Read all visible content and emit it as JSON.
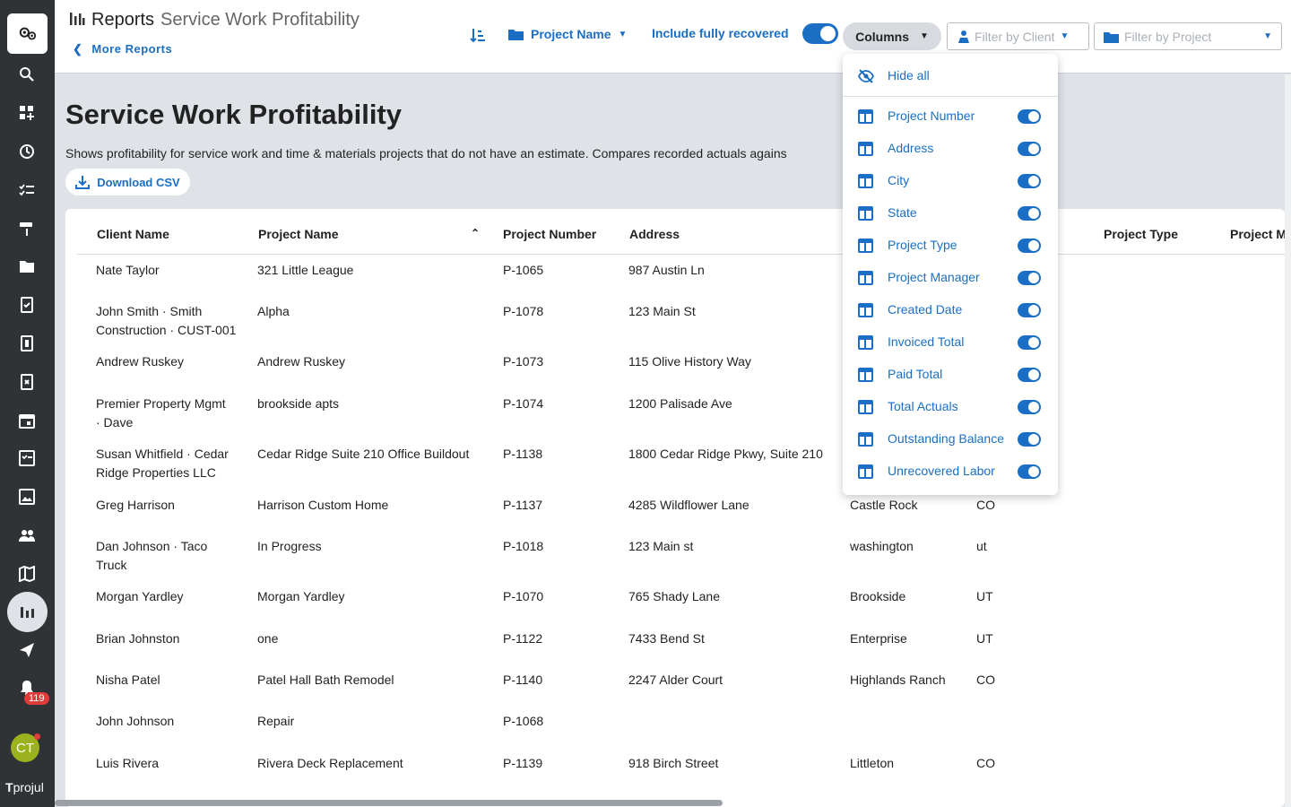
{
  "app": {
    "brand": "projul",
    "notification_count": "119",
    "avatar_initials": "CT"
  },
  "sidebar": {
    "items": [
      {
        "icon": "search-icon"
      },
      {
        "icon": "dashboard-add-icon"
      },
      {
        "icon": "clock-icon"
      },
      {
        "icon": "checklist-icon"
      },
      {
        "icon": "paint-roller-icon"
      },
      {
        "icon": "folder-icon"
      },
      {
        "icon": "estimate-icon"
      },
      {
        "icon": "invoice-icon"
      },
      {
        "icon": "document-x-icon"
      },
      {
        "icon": "calendar-icon"
      },
      {
        "icon": "task-box-icon"
      },
      {
        "icon": "photo-icon"
      },
      {
        "icon": "people-icon"
      },
      {
        "icon": "map-icon"
      },
      {
        "icon": "bar-chart-icon"
      },
      {
        "icon": "send-icon"
      },
      {
        "icon": "bell-icon"
      }
    ]
  },
  "header": {
    "title": "Reports",
    "subtitle": "Service Work Profitability",
    "back_link": "More Reports",
    "group_by": "Project Name",
    "include_label": "Include fully recovered",
    "columns_label": "Columns",
    "filter_client_placeholder": "Filter by Client",
    "filter_project_placeholder": "Filter by Project"
  },
  "page": {
    "title": "Service Work Profitability",
    "description": "Shows profitability for service work and time & materials projects that do not have an estimate. Compares recorded actuals agains",
    "download_label": "Download CSV"
  },
  "table": {
    "headers": [
      "Client Name",
      "Project Name",
      "Project Number",
      "Address",
      "Project Type",
      "Project M"
    ],
    "rows": [
      {
        "client": [
          "Nate Taylor"
        ],
        "project": "321 Little League",
        "number": "P-1065",
        "address": "987 Austin Ln",
        "city": "",
        "state": ""
      },
      {
        "client": [
          "John Smith · Smith",
          "Construction · CUST-001"
        ],
        "project": "Alpha",
        "number": "P-1078",
        "address": "123 Main St",
        "city": "",
        "state": ""
      },
      {
        "client": [
          "Andrew Ruskey"
        ],
        "project": "Andrew Ruskey",
        "number": "P-1073",
        "address": "115 Olive History Way",
        "city": "",
        "state": ""
      },
      {
        "client": [
          "Premier Property Mgmt",
          "· Dave"
        ],
        "project": "brookside apts",
        "number": "P-1074",
        "address": "1200 Palisade Ave",
        "city": "",
        "state": ""
      },
      {
        "client": [
          "Susan Whitfield · Cedar",
          "Ridge Properties LLC"
        ],
        "project": "Cedar Ridge Suite 210 Office Buildout",
        "number": "P-1138",
        "address": "1800 Cedar Ridge Pkwy, Suite 210",
        "city": "",
        "state": ""
      },
      {
        "client": [
          "Greg Harrison"
        ],
        "project": "Harrison Custom Home",
        "number": "P-1137",
        "address": "4285 Wildflower Lane",
        "city": "Castle Rock",
        "state": "CO"
      },
      {
        "client": [
          "Dan Johnson · Taco",
          "Truck"
        ],
        "project": "In Progress",
        "number": "P-1018",
        "address": "123 Main st",
        "city": "washington",
        "state": "ut"
      },
      {
        "client": [
          "Morgan Yardley"
        ],
        "project": "Morgan Yardley",
        "number": "P-1070",
        "address": "765 Shady Lane",
        "city": "Brookside",
        "state": "UT"
      },
      {
        "client": [
          "Brian Johnston"
        ],
        "project": "one",
        "number": "P-1122",
        "address": "7433 Bend St",
        "city": "Enterprise",
        "state": "UT"
      },
      {
        "client": [
          "Nisha Patel"
        ],
        "project": "Patel Hall Bath Remodel",
        "number": "P-1140",
        "address": "2247 Alder Court",
        "city": "Highlands Ranch",
        "state": "CO"
      },
      {
        "client": [
          "John Johnson"
        ],
        "project": "Repair",
        "number": "P-1068",
        "address": "",
        "city": "",
        "state": ""
      },
      {
        "client": [
          "Luis Rivera"
        ],
        "project": "Rivera Deck Replacement",
        "number": "P-1139",
        "address": "918 Birch Street",
        "city": "Littleton",
        "state": "CO"
      }
    ]
  },
  "columns_menu": {
    "hide_all_label": "Hide all",
    "items": [
      {
        "label": "Project Number",
        "enabled": true
      },
      {
        "label": "Address",
        "enabled": true
      },
      {
        "label": "City",
        "enabled": true
      },
      {
        "label": "State",
        "enabled": true
      },
      {
        "label": "Project Type",
        "enabled": true
      },
      {
        "label": "Project Manager",
        "enabled": true
      },
      {
        "label": "Created Date",
        "enabled": true
      },
      {
        "label": "Invoiced Total",
        "enabled": true
      },
      {
        "label": "Paid Total",
        "enabled": true
      },
      {
        "label": "Total Actuals",
        "enabled": true
      },
      {
        "label": "Outstanding Balance",
        "enabled": true
      },
      {
        "label": "Unrecovered Labor",
        "enabled": true
      }
    ]
  },
  "colors": {
    "accent": "#1a6fc4",
    "sidebar": "#2f3336",
    "badge": "#e23b3b",
    "avatar": "#9bb21e"
  }
}
